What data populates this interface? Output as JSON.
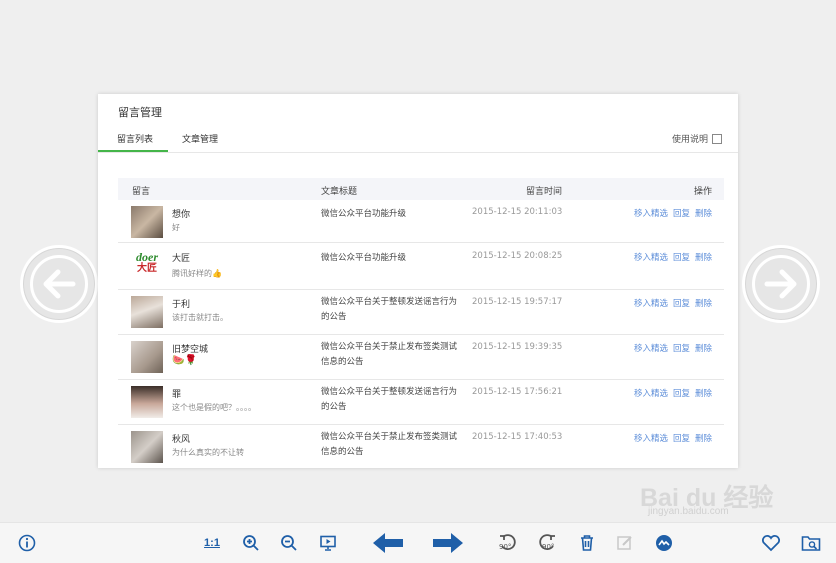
{
  "panel": {
    "title": "留言管理",
    "tabs": [
      {
        "label": "留言列表"
      },
      {
        "label": "文章管理"
      }
    ],
    "help_label": "使用说明"
  },
  "table": {
    "headers": {
      "message": "留言",
      "article": "文章标题",
      "time": "留言时间",
      "ops": "操作"
    },
    "ops_labels": {
      "select": "移入精选",
      "reply": "回复",
      "delete": "删除"
    },
    "rows": [
      {
        "name": "想你",
        "message": "好",
        "article": "微信公众平台功能升级",
        "time": "2015-12-15 20:11:03"
      },
      {
        "name": "大匠",
        "message": "腾讯好样的👍",
        "article": "微信公众平台功能升级",
        "time": "2015-12-15 20:08:25"
      },
      {
        "name": "于利",
        "message": "该打击就打击。",
        "article": "微信公众平台关于整顿发送谣言行为的公告",
        "time": "2015-12-15 19:57:17"
      },
      {
        "name": "旧梦空城",
        "message": "🍉🌹",
        "article": "微信公众平台关于禁止发布签类测试信息的公告",
        "time": "2015-12-15 19:39:35"
      },
      {
        "name": "罪",
        "message": "这个也是假的吧？。。。。",
        "article": "微信公众平台关于整顿发送谣言行为的公告",
        "time": "2015-12-15 17:56:21"
      },
      {
        "name": "秋风",
        "message": "为什么真实的不让转",
        "article": "微信公众平台关于禁止发布签类测试信息的公告",
        "time": "2015-12-15 17:40:53"
      }
    ],
    "avatar_logo_text": {
      "brand": "doer",
      "sub": "大匠"
    }
  },
  "watermark": {
    "logo": "Bai du 经验",
    "url": "jingyan.baidu.com"
  },
  "toolbar": {
    "actual_size_label": "1:1",
    "rotate_label": "90°"
  },
  "colors": {
    "accent_green": "#44b549",
    "link_blue": "#5d8ed9",
    "toolbar_blue": "#1f5fa8"
  }
}
